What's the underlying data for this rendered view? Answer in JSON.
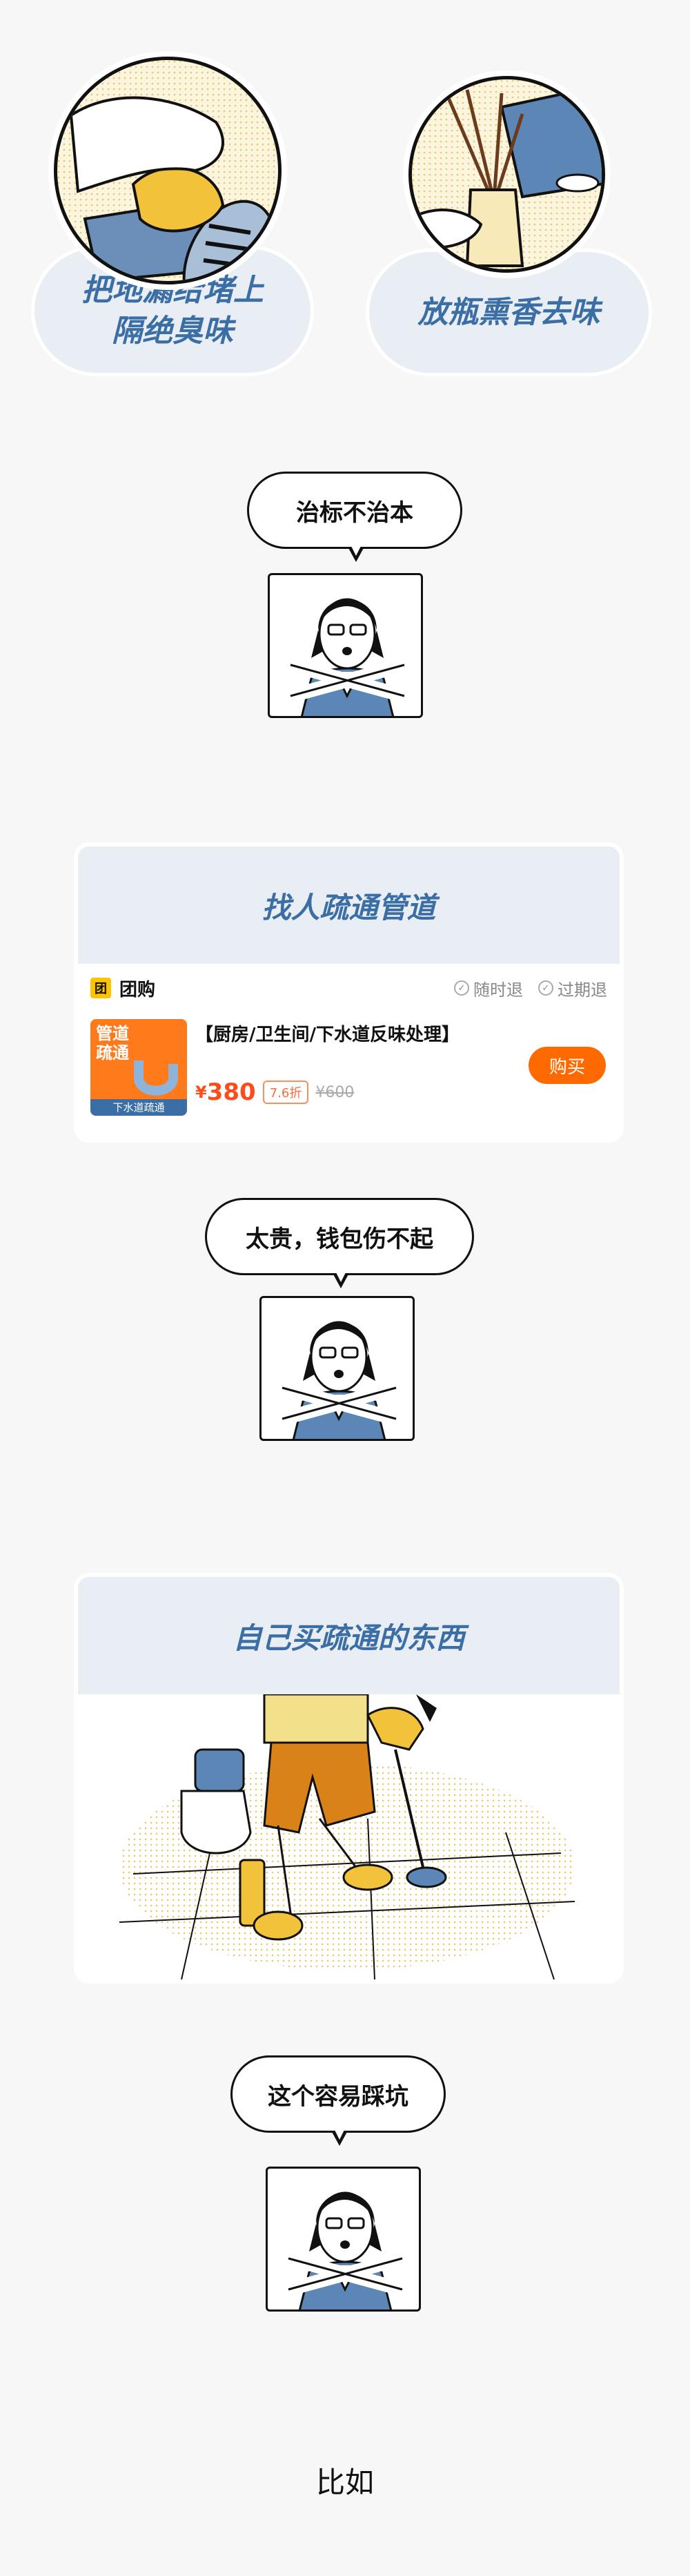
{
  "tips": [
    {
      "label": "把地漏给堵上\n隔绝臭味"
    },
    {
      "label": "放瓶熏香去味"
    }
  ],
  "bubble1": {
    "text": "治标不治本"
  },
  "card1": {
    "title": "找人疏通管道",
    "tag_label": "团",
    "group_label": "团购",
    "anytime_refund": "随时退",
    "expired_refund": "过期退",
    "thumb_text1": "管道",
    "thumb_text2": "疏通",
    "thumb_footer": "下水道疏通",
    "product_name": "【厨房/卫生间/下水道反味处理】",
    "currency": "¥",
    "price": "380",
    "discount": "7.6折",
    "original_price": "¥600",
    "buy_label": "购买"
  },
  "bubble2": {
    "text": "太贵，钱包伤不起"
  },
  "card2": {
    "title": "自己买疏通的东西"
  },
  "bubble3": {
    "text": "这个容易踩坑"
  },
  "footer": {
    "text": "比如"
  },
  "colors": {
    "accent_blue": "#3a6ea5",
    "light_blue": "#e9eef5",
    "orange": "#ff6a00",
    "yellow": "#f2c23a"
  }
}
